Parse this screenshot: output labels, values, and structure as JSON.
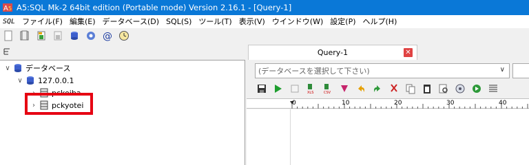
{
  "window": {
    "title": "A5:SQL Mk-2 64bit edition (Portable mode) Version 2.16.1 - [Query-1]"
  },
  "menu": {
    "sql_logo": "SQL",
    "items": [
      {
        "label": "ファイル(F)"
      },
      {
        "label": "編集(E)"
      },
      {
        "label": "データベース(D)"
      },
      {
        "label": "SQL(S)"
      },
      {
        "label": "ツール(T)"
      },
      {
        "label": "表示(V)"
      },
      {
        "label": "ウインドウ(W)"
      },
      {
        "label": "設定(P)"
      },
      {
        "label": "ヘルプ(H)"
      }
    ]
  },
  "toolbar1": {
    "icons": [
      "new-icon",
      "open-icon",
      "connect-icon",
      "disconnect-icon",
      "database-icon",
      "settings-icon",
      "at-icon",
      "clock-icon"
    ]
  },
  "tree": {
    "root_label": "データベース",
    "host_label": "127.0.0.1",
    "db1_label": "pckeiba",
    "db2_label": "pckyotei"
  },
  "tabs": [
    {
      "label": "Query-1",
      "active": true
    }
  ],
  "db_select": {
    "placeholder": "(データベースを選択して下さい)"
  },
  "toolbar2": {
    "icons": [
      "save-icon",
      "run-icon",
      "stop-icon",
      "export-xls-icon",
      "export-csv-icon",
      "explain-icon",
      "undo-icon",
      "redo-icon",
      "cut-icon",
      "copy-icon",
      "paste-icon",
      "find-icon",
      "format-icon",
      "refresh-icon",
      "indent-icon"
    ]
  },
  "ruler": {
    "labels": [
      "0",
      "10",
      "20",
      "30",
      "40"
    ]
  },
  "colors": {
    "titlebar": "#0a78d7",
    "highlight": "#e60012",
    "tab_close": "#e04343"
  }
}
